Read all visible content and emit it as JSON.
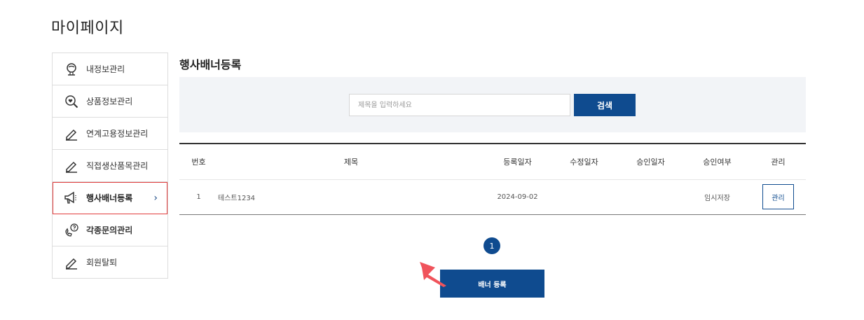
{
  "page": {
    "title": "마이페이지"
  },
  "sidebar": {
    "items": [
      {
        "label": "내정보관리",
        "icon": "user-icon"
      },
      {
        "label": "상품정보관리",
        "icon": "search-heart-icon"
      },
      {
        "label": "연계고용정보관리",
        "icon": "pencil-icon"
      },
      {
        "label": "직접생산품목관리",
        "icon": "pencil-icon"
      },
      {
        "label": "행사배너등록",
        "icon": "megaphone-icon",
        "active": true,
        "chevron": "›"
      },
      {
        "label": "각종문의관리",
        "icon": "phone-question-icon"
      },
      {
        "label": "회원탈퇴",
        "icon": "pencil-icon"
      }
    ]
  },
  "main": {
    "title": "행사배너등록",
    "search": {
      "placeholder": "제목을 입력하세요",
      "value": "",
      "button_label": "검색"
    },
    "table": {
      "headers": [
        "번호",
        "제목",
        "등록일자",
        "수정일자",
        "승인일자",
        "승인여부",
        "관리"
      ],
      "rows": [
        {
          "no": "1",
          "title": "테스트1234",
          "registered": "2024-09-02",
          "modified": "",
          "approved": "",
          "status": "임시저장",
          "action": "관리"
        }
      ]
    },
    "pagination": {
      "current": "1"
    },
    "register_button": "배너 등록"
  },
  "colors": {
    "primary": "#0f4b8f",
    "active_border": "#e23c3c",
    "search_bg": "#f2f4f7",
    "arrow": "#f0535b"
  }
}
